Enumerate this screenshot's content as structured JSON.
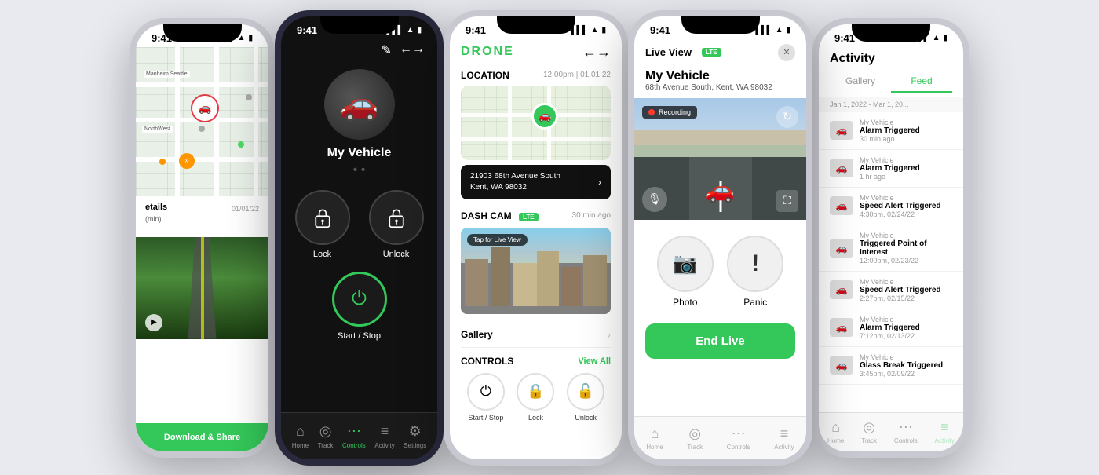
{
  "phones": [
    {
      "id": "phone1",
      "time": "9:41",
      "title": "etails",
      "subtitle": "(min)",
      "date": "01/01/22",
      "download_label": "Download & Share",
      "map_labels": [
        "Manheim Seattle Auto Auction",
        "NorthWest Corporate Park"
      ]
    },
    {
      "id": "phone2",
      "time": "9:41",
      "vehicle_name": "My Vehicle",
      "lock_label": "Lock",
      "unlock_label": "Unlock",
      "startstop_label": "Start / Stop",
      "nav": [
        "Home",
        "Track",
        "Controls",
        "Activity",
        "Settings"
      ]
    },
    {
      "id": "phone3",
      "time": "9:41",
      "logo": "DRONE",
      "location_title": "LOCATION",
      "location_time": "12:00pm | 01.01.22",
      "address_line1": "21903 68th Avenue South",
      "address_line2": "Kent, WA 98032",
      "dashcam_title": "DASH CAM",
      "dashcam_badge": "LTE",
      "dashcam_time": "30 min ago",
      "tap_live": "Tap for Live View",
      "gallery_label": "Gallery",
      "controls_title": "CONTROLS",
      "view_all": "View All",
      "mini_controls": [
        "Start / Stop",
        "Lock",
        "Unlock"
      ]
    },
    {
      "id": "phone4",
      "time": "9:41",
      "liveview_title": "Live View",
      "lte_badge": "LTE",
      "vehicle_name": "My Vehicle",
      "vehicle_address": "68th Avenue South, Kent, WA 98032",
      "recording_label": "Recording",
      "photo_label": "Photo",
      "panic_label": "Panic",
      "end_live_label": "End Live"
    },
    {
      "id": "phone5",
      "time": "9:41",
      "activity_title": "Activity",
      "tabs": [
        "Gallery",
        "Feed"
      ],
      "date_range": "Jan 1, 2022 - Mar 1, 20...",
      "items": [
        {
          "vehicle": "My Vehicle",
          "event": "Alarm Triggered",
          "time": "30 min ago"
        },
        {
          "vehicle": "My Vehicle",
          "event": "Alarm Triggered",
          "time": "1 hr ago"
        },
        {
          "vehicle": "My Vehicle",
          "event": "Speed Alert Triggered",
          "time": "4:30pm, 02/24/22"
        },
        {
          "vehicle": "My Vehicle",
          "event": "Triggered Point of Interest",
          "time": "12:00pm, 02/23/22"
        },
        {
          "vehicle": "My Vehicle",
          "event": "Speed Alert Triggered",
          "time": "2:27pm, 02/15/22"
        },
        {
          "vehicle": "My Vehicle",
          "event": "Alarm Triggered",
          "time": "7:12pm, 02/13/22"
        },
        {
          "vehicle": "My Vehicle",
          "event": "Glass Break Triggered",
          "time": "3:45pm, 02/09/22"
        }
      ]
    }
  ],
  "colors": {
    "green": "#34c759",
    "dark_bg": "#111111",
    "white": "#ffffff"
  }
}
